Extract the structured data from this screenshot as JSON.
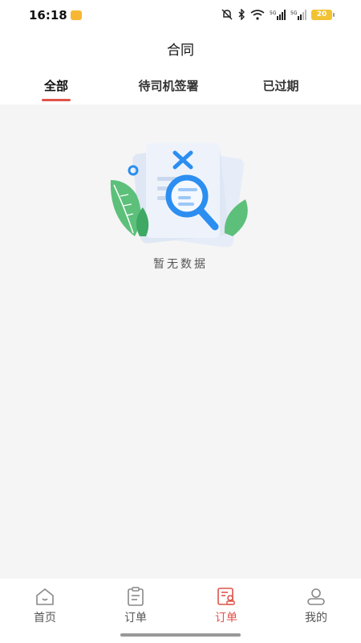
{
  "status_bar": {
    "time": "16:18",
    "battery": "20",
    "icons": [
      "bell-muted-icon",
      "bluetooth-icon",
      "wifi-icon",
      "signal-5g-icon",
      "signal-5g-icon"
    ]
  },
  "header": {
    "title": "合同"
  },
  "tabs": [
    {
      "label": "全部",
      "active": true
    },
    {
      "label": "待司机签署",
      "active": false
    },
    {
      "label": "已过期",
      "active": false
    }
  ],
  "empty_state": {
    "text": "暂无数据",
    "illustration": "empty-search-document-icon"
  },
  "bottom_nav": [
    {
      "label": "首页",
      "icon": "home-icon",
      "active": false
    },
    {
      "label": "订单",
      "icon": "clipboard-icon",
      "active": false
    },
    {
      "label": "订单",
      "icon": "contract-icon",
      "active": true
    },
    {
      "label": "我的",
      "icon": "user-icon",
      "active": false
    }
  ],
  "colors": {
    "accent": "#e0534a",
    "background": "#f5f5f5",
    "illustration_blue": "#2b8ef0",
    "illustration_green": "#5cc07a"
  }
}
